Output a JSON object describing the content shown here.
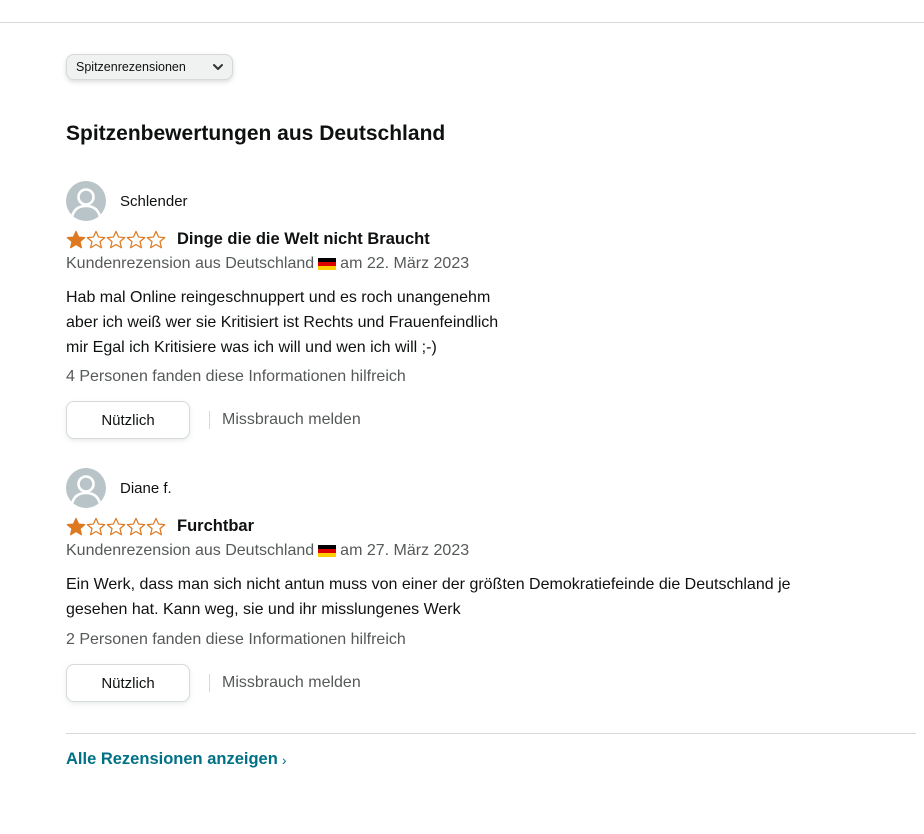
{
  "sort": {
    "label": "Spitzenrezensionen",
    "icon": "chevron-down-icon"
  },
  "section_heading": "Spitzenbewertungen aus Deutschland",
  "reviews": [
    {
      "author": "Schlender",
      "rating": 1,
      "max_rating": 5,
      "title": "Dinge die die Welt nicht Braucht",
      "meta_prefix": "Kundenrezension aus Deutschland",
      "date": "am 22. März 2023",
      "body": [
        "Hab mal Online reingeschnuppert und es roch unangenehm",
        "aber ich weiß wer sie Kritisiert ist Rechts und Frauenfeindlich",
        "mir Egal ich Kritisiere was ich will und wen ich will ;-)"
      ],
      "helpful_text": "4 Personen fanden diese Informationen hilfreich",
      "helpful_button": "Nützlich",
      "report_link": "Missbrauch melden"
    },
    {
      "author": "Diane f.",
      "rating": 1,
      "max_rating": 5,
      "title": "Furchtbar",
      "meta_prefix": "Kundenrezension aus Deutschland",
      "date": "am 27. März 2023",
      "body": [
        "Ein Werk, dass man sich nicht antun muss von einer der größten Demokratiefeinde die Deutschland je",
        "gesehen hat. Kann weg, sie und ihr misslungenes Werk"
      ],
      "helpful_text": "2 Personen fanden diese Informationen hilfreich",
      "helpful_button": "Nützlich",
      "report_link": "Missbrauch melden"
    }
  ],
  "all_reviews_link": "Alle Rezensionen anzeigen",
  "all_reviews_arrow": "›",
  "colors": {
    "star": "#de7921",
    "link": "#007185",
    "avatar": "#b9c4c9",
    "secondary_text": "#565959"
  },
  "flag_colors": [
    "#000000",
    "#dd0000",
    "#ffce00"
  ]
}
